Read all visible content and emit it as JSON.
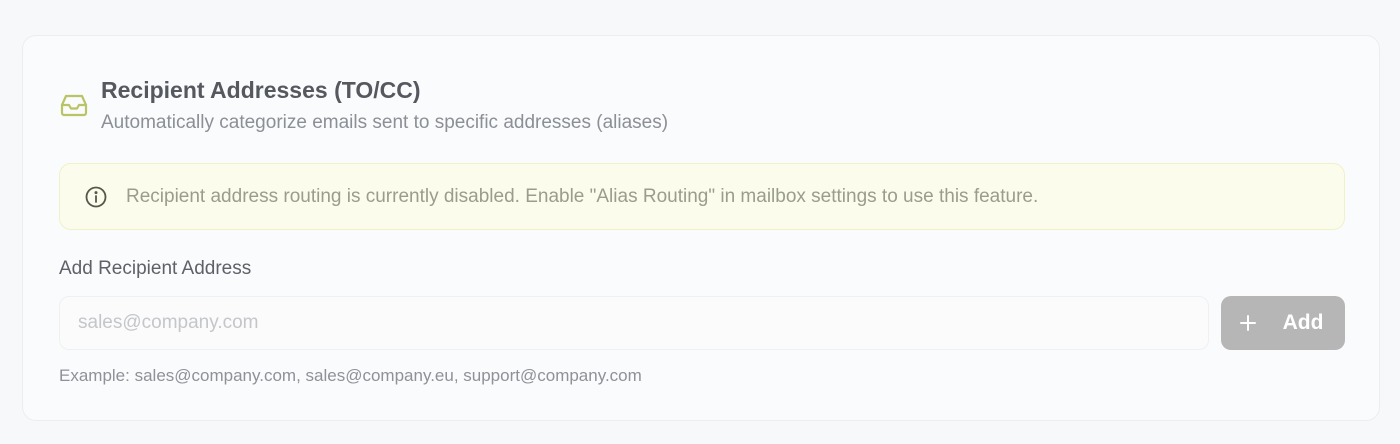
{
  "section": {
    "icon": "inbox-icon",
    "title": "Recipient Addresses (TO/CC)",
    "subtitle": "Automatically categorize emails sent to specific addresses (aliases)",
    "accent_color": "#b9c466"
  },
  "alert": {
    "icon": "info-circle-icon",
    "text": "Recipient address routing is currently disabled. Enable \"Alias Routing\" in mailbox settings to use this feature.",
    "background": "#fcfcec",
    "border": "#f0f1c9"
  },
  "add_form": {
    "label": "Add Recipient Address",
    "input_value": "",
    "input_placeholder": "sales@company.com",
    "button_label": "Add",
    "button_icon": "plus-icon",
    "button_color": "#b6b6b6",
    "hint": "Example: sales@company.com, sales@company.eu, support@company.com"
  }
}
